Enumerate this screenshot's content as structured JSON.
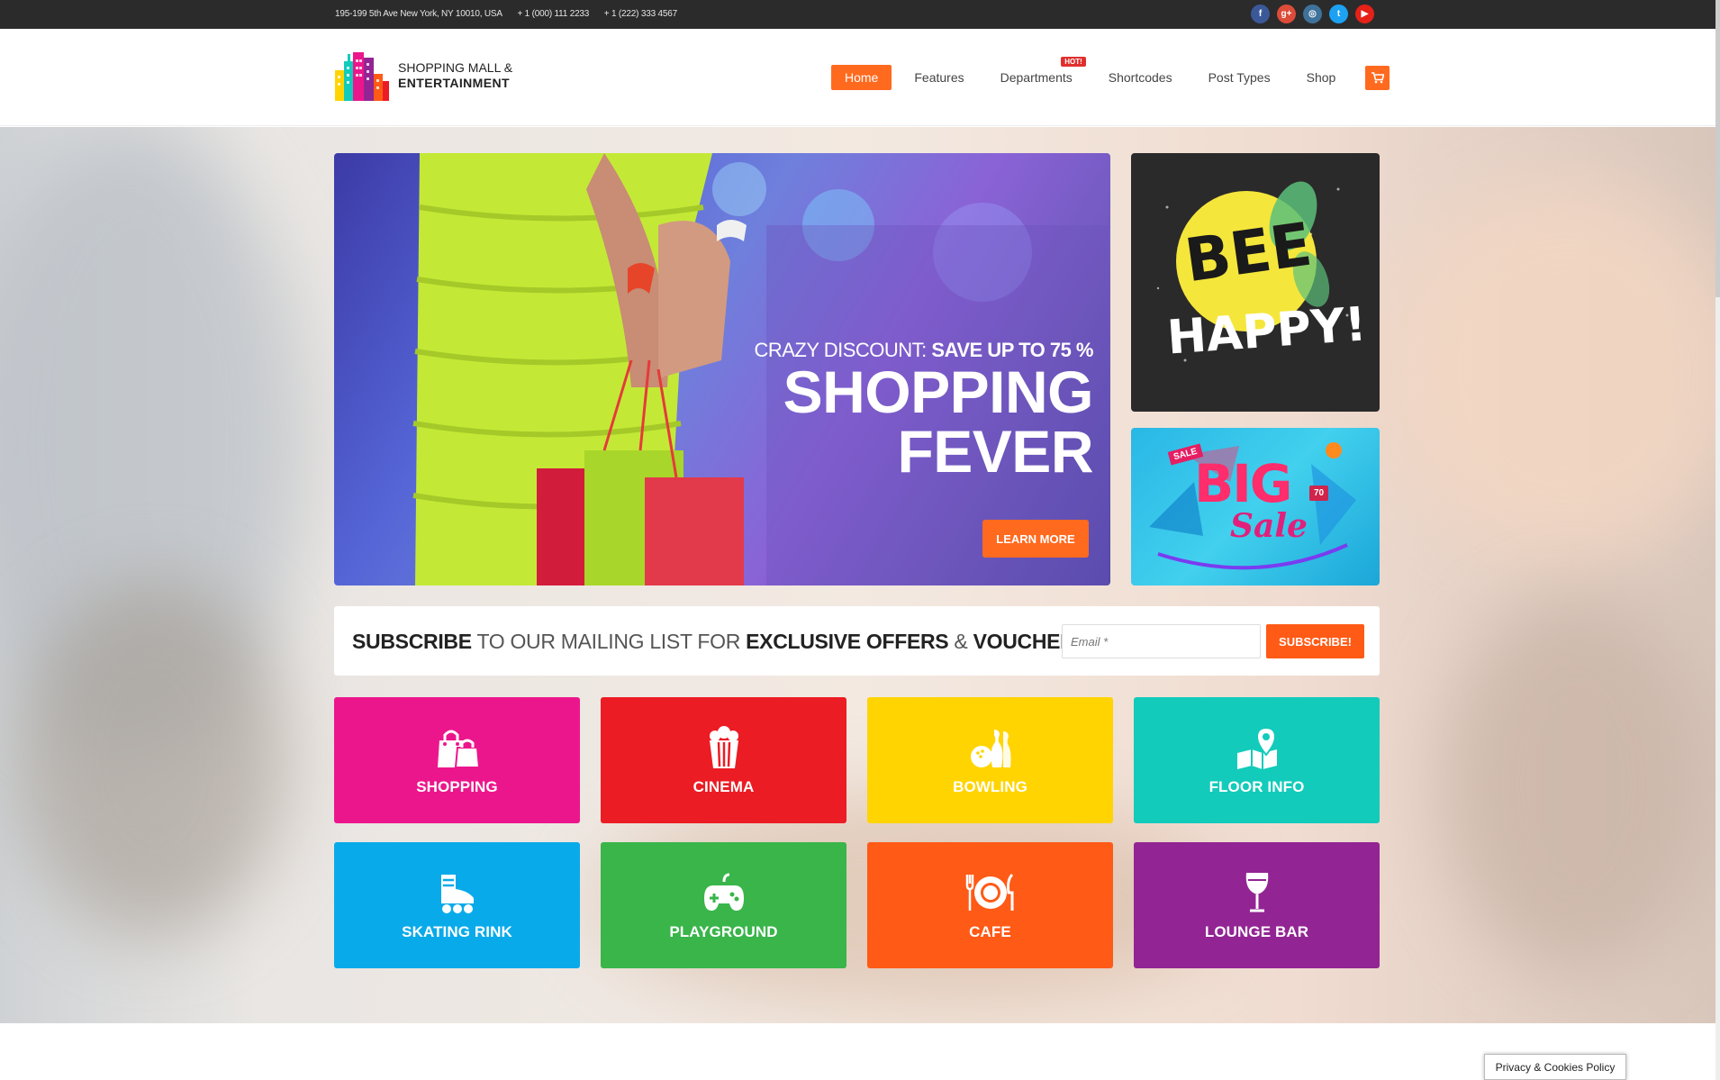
{
  "topbar": {
    "address": "195-199 5th Ave New York, NY 10010, USA",
    "phone1": "+ 1 (000) 111 2233",
    "phone2": "+ 1 (222) 333 4567",
    "social": [
      {
        "icon": "facebook-icon",
        "glyph": "f",
        "color": "#3b5998"
      },
      {
        "icon": "google-plus-icon",
        "glyph": "g+",
        "color": "#dd4b39"
      },
      {
        "icon": "instagram-icon",
        "glyph": "◎",
        "color": "#3f729b"
      },
      {
        "icon": "twitter-icon",
        "glyph": "t",
        "color": "#1da1f2"
      },
      {
        "icon": "youtube-icon",
        "glyph": "▶",
        "color": "#e62117"
      }
    ]
  },
  "logo": {
    "line1": "SHOPPING MALL &",
    "line2": "ENTERTAINMENT"
  },
  "nav": {
    "items": [
      "Home",
      "Features",
      "Departments",
      "Shortcodes",
      "Post Types",
      "Shop"
    ],
    "hot_badge": "HOT!"
  },
  "hero": {
    "subtitle_light": "CRAZY DISCOUNT:",
    "subtitle_bold": "SAVE UP TO 75 %",
    "title_line1": "SHOPPING",
    "title_line2": "FEVER",
    "button": "LEARN MORE"
  },
  "ads": {
    "ad1_line1": "BEE",
    "ad1_line2": "HAPPY!",
    "ad2_sale_tag": "SALE",
    "ad2_big": "BIG",
    "ad2_sale": "Sale",
    "ad2_percent": "70"
  },
  "subscribe": {
    "w1": "SUBSCRIBE",
    "w2": " TO OUR MAILING LIST FOR ",
    "w3": "EXCLUSIVE OFFERS",
    "w4": " & ",
    "w5": "VOUCHERS!",
    "email_placeholder": "Email *",
    "button": "SUBSCRIBE!"
  },
  "tiles": [
    {
      "label": "SHOPPING",
      "icon": "shopping-bags-icon",
      "color": "#ec168c"
    },
    {
      "label": "CINEMA",
      "icon": "popcorn-icon",
      "color": "#ec1c24"
    },
    {
      "label": "BOWLING",
      "icon": "bowling-icon",
      "color": "#ffd400"
    },
    {
      "label": "FLOOR INFO",
      "icon": "map-pin-icon",
      "color": "#12cbbb"
    },
    {
      "label": "SKATING RINK",
      "icon": "roller-skate-icon",
      "color": "#09aaea"
    },
    {
      "label": "PLAYGROUND",
      "icon": "gamepad-icon",
      "color": "#39b54a"
    },
    {
      "label": "CAFE",
      "icon": "plate-cutlery-icon",
      "color": "#ff5a16"
    },
    {
      "label": "LOUNGE BAR",
      "icon": "wine-glass-icon",
      "color": "#922593"
    }
  ],
  "privacy": "Privacy & Cookies Policy"
}
